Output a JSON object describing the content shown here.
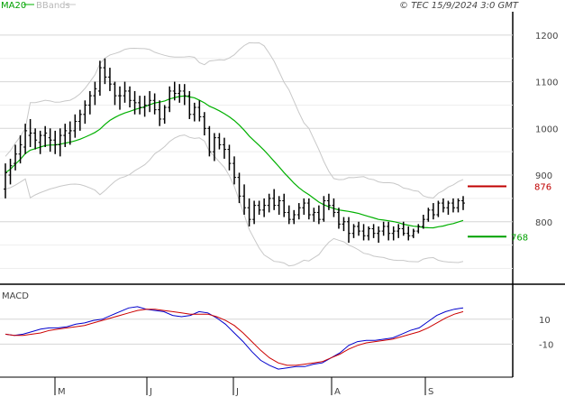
{
  "header": {
    "ma_label": "MA20",
    "bbands_label": "BBands",
    "copyright": "© TEC 15/9/2024 3:0 GMT"
  },
  "price_panel": {
    "y_ticks": [
      "1200",
      "1100",
      "1000",
      "900",
      "800"
    ],
    "resistance_label": "876",
    "support_label": "768",
    "colors": {
      "ma": "#00b000",
      "bbands": "#c8c8c8",
      "bars": "#000000",
      "resistance": "#c00000",
      "support": "#00a000"
    }
  },
  "macd_panel": {
    "title": "MACD",
    "y_ticks": [
      "10",
      "-10"
    ],
    "colors": {
      "macd": "#0000cc",
      "signal": "#cc0000"
    }
  },
  "x_ticks": [
    "M",
    "J",
    "J",
    "A",
    "S"
  ],
  "chart_data": [
    {
      "type": "ohlc",
      "x": [
        "May",
        "Jun",
        "Jul",
        "Aug",
        "Sep"
      ],
      "ylim": [
        670,
        1250
      ],
      "levels": {
        "resistance": 876,
        "support": 768
      },
      "series": [
        {
          "values": [
            [
              870,
              925,
              850,
              905
            ],
            [
              900,
              935,
              880,
              920
            ],
            [
              925,
              965,
              910,
              945
            ],
            [
              945,
              985,
              925,
              965
            ],
            [
              960,
              1010,
              945,
              995
            ],
            [
              985,
              1020,
              960,
              990
            ],
            [
              990,
              1000,
              955,
              975
            ],
            [
              970,
              995,
              945,
              985
            ],
            [
              985,
              1005,
              960,
              990
            ],
            [
              980,
              1000,
              950,
              975
            ],
            [
              975,
              995,
              945,
              965
            ],
            [
              965,
              1000,
              940,
              985
            ],
            [
              985,
              1010,
              960,
              995
            ],
            [
              990,
              1015,
              965,
              995
            ],
            [
              995,
              1030,
              980,
              1015
            ],
            [
              1015,
              1040,
              995,
              1030
            ],
            [
              1030,
              1060,
              1010,
              1050
            ],
            [
              1050,
              1080,
              1030,
              1070
            ],
            [
              1070,
              1100,
              1050,
              1085
            ],
            [
              1080,
              1145,
              1070,
              1130
            ],
            [
              1130,
              1150,
              1095,
              1110
            ],
            [
              1110,
              1130,
              1080,
              1095
            ],
            [
              1095,
              1100,
              1050,
              1070
            ],
            [
              1070,
              1090,
              1040,
              1070
            ],
            [
              1070,
              1100,
              1055,
              1080
            ],
            [
              1080,
              1090,
              1045,
              1060
            ],
            [
              1060,
              1080,
              1030,
              1055
            ],
            [
              1055,
              1070,
              1030,
              1045
            ],
            [
              1045,
              1070,
              1025,
              1050
            ],
            [
              1050,
              1080,
              1035,
              1060
            ],
            [
              1060,
              1075,
              1030,
              1040
            ],
            [
              1040,
              1060,
              1005,
              1020
            ],
            [
              1020,
              1050,
              1010,
              1045
            ],
            [
              1045,
              1090,
              1035,
              1080
            ],
            [
              1080,
              1100,
              1060,
              1075
            ],
            [
              1075,
              1095,
              1055,
              1080
            ],
            [
              1080,
              1095,
              1050,
              1070
            ],
            [
              1070,
              1080,
              1020,
              1030
            ],
            [
              1030,
              1055,
              1015,
              1045
            ],
            [
              1045,
              1060,
              1015,
              1025
            ],
            [
              1025,
              1035,
              985,
              1000
            ],
            [
              1000,
              1005,
              940,
              950
            ],
            [
              950,
              990,
              930,
              980
            ],
            [
              980,
              990,
              955,
              965
            ],
            [
              965,
              980,
              935,
              955
            ],
            [
              955,
              965,
              910,
              925
            ],
            [
              925,
              940,
              880,
              895
            ],
            [
              895,
              905,
              840,
              855
            ],
            [
              855,
              880,
              815,
              830
            ],
            [
              830,
              850,
              790,
              805
            ],
            [
              805,
              845,
              795,
              835
            ],
            [
              835,
              845,
              815,
              825
            ],
            [
              825,
              850,
              810,
              835
            ],
            [
              835,
              860,
              820,
              850
            ],
            [
              850,
              870,
              825,
              835
            ],
            [
              835,
              855,
              815,
              845
            ],
            [
              845,
              860,
              810,
              820
            ],
            [
              820,
              835,
              795,
              805
            ],
            [
              805,
              825,
              795,
              815
            ],
            [
              815,
              840,
              805,
              830
            ],
            [
              830,
              850,
              815,
              840
            ],
            [
              840,
              850,
              805,
              815
            ],
            [
              815,
              830,
              800,
              820
            ],
            [
              820,
              835,
              795,
              805
            ],
            [
              805,
              855,
              800,
              845
            ],
            [
              845,
              860,
              825,
              835
            ],
            [
              835,
              850,
              810,
              820
            ],
            [
              820,
              830,
              785,
              795
            ],
            [
              795,
              810,
              780,
              800
            ],
            [
              800,
              810,
              755,
              775
            ],
            [
              775,
              795,
              765,
              790
            ],
            [
              790,
              800,
              770,
              780
            ],
            [
              780,
              795,
              760,
              770
            ],
            [
              770,
              790,
              760,
              785
            ],
            [
              785,
              795,
              765,
              775
            ],
            [
              775,
              790,
              755,
              780
            ],
            [
              780,
              800,
              770,
              790
            ],
            [
              790,
              800,
              760,
              775
            ],
            [
              775,
              790,
              760,
              780
            ],
            [
              780,
              795,
              765,
              785
            ],
            [
              785,
              800,
              770,
              775
            ],
            [
              775,
              790,
              760,
              770
            ],
            [
              770,
              785,
              765,
              780
            ],
            [
              780,
              795,
              775,
              790
            ],
            [
              790,
              815,
              785,
              805
            ],
            [
              805,
              830,
              800,
              825
            ],
            [
              825,
              840,
              805,
              815
            ],
            [
              815,
              845,
              810,
              840
            ],
            [
              840,
              850,
              820,
              830
            ],
            [
              830,
              845,
              815,
              840
            ],
            [
              840,
              850,
              820,
              830
            ],
            [
              830,
              850,
              820,
              845
            ],
            [
              845,
              855,
              825,
              840
            ]
          ]
        }
      ]
    },
    {
      "type": "line",
      "title": "MACD",
      "ylim": [
        -35,
        25
      ],
      "series": [
        {
          "values": [
            -2,
            -3,
            -2,
            0,
            2,
            3,
            3,
            4,
            6,
            7,
            9,
            10,
            13,
            16,
            19,
            20,
            18,
            17,
            16,
            13,
            12,
            13,
            16,
            15,
            11,
            6,
            -1,
            -8,
            -16,
            -23,
            -27,
            -30,
            -29,
            -28,
            -28,
            -26,
            -25,
            -21,
            -17,
            -11,
            -8,
            -7,
            -7,
            -6,
            -5,
            -2,
            1,
            3,
            8,
            13,
            16,
            18,
            19
          ]
        },
        {
          "values": [
            -2,
            -3,
            -3,
            -2,
            -1,
            1,
            2,
            3,
            4,
            5,
            7,
            9,
            11,
            13,
            15,
            17,
            18,
            18,
            17,
            16,
            15,
            14,
            14,
            14,
            12,
            9,
            5,
            -1,
            -8,
            -15,
            -21,
            -25,
            -27,
            -27,
            -26,
            -25,
            -24,
            -21,
            -18,
            -14,
            -11,
            -9,
            -8,
            -7,
            -6,
            -4,
            -2,
            0,
            3,
            7,
            11,
            14,
            16
          ]
        }
      ]
    }
  ]
}
